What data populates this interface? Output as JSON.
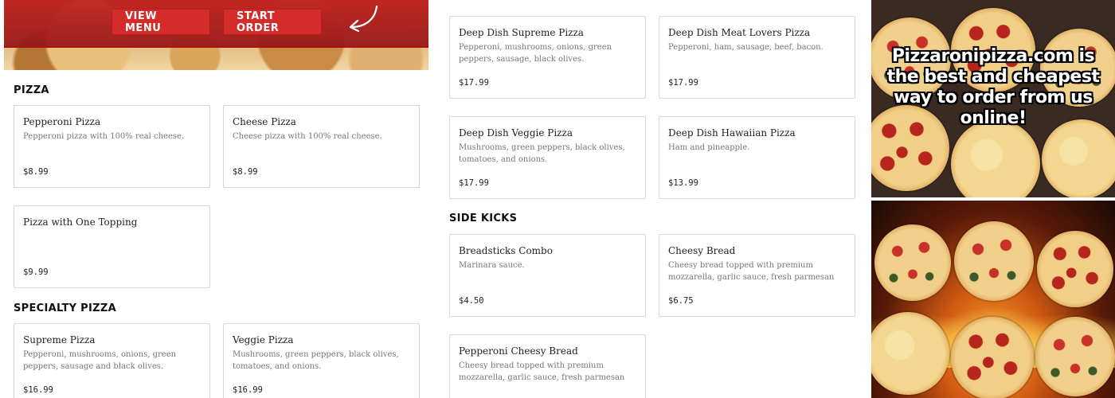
{
  "hero": {
    "view_menu_label": "VIEW MENU",
    "start_order_label": "START ORDER",
    "accent_color": "#d42b2b"
  },
  "sections": {
    "pizza": "PIZZA",
    "specialty_pizza": "SPECIALTY PIZZA",
    "side_kicks": "SIDE KICKS"
  },
  "items": {
    "pepperoni": {
      "name": "Pepperoni Pizza",
      "desc": "Pepperoni pizza with 100% real cheese.",
      "price": "$8.99"
    },
    "cheese": {
      "name": "Cheese Pizza",
      "desc": "Cheese pizza with 100% real cheese.",
      "price": "$8.99"
    },
    "one_topping": {
      "name": "Pizza with One Topping",
      "desc": "",
      "price": "$9.99"
    },
    "supreme": {
      "name": "Supreme Pizza",
      "desc": "Pepperoni, mushrooms, onions, green peppers, sausage and black olives.",
      "price": "$16.99"
    },
    "veggie": {
      "name": "Veggie Pizza",
      "desc": "Mushrooms, green peppers, black olives, tomatoes, and onions.",
      "price": "$16.99"
    },
    "dd_supreme": {
      "name": "Deep Dish Supreme Pizza",
      "desc": "Pepperoni, mushrooms, onions, green peppers, sausage, black olives.",
      "price": "$17.99"
    },
    "dd_meat": {
      "name": "Deep Dish Meat Lovers Pizza",
      "desc": "Pepperoni, ham, sausage, beef, bacon.",
      "price": "$17.99"
    },
    "dd_veggie": {
      "name": "Deep Dish Veggie Pizza",
      "desc": "Mushrooms, green peppers, black olives, tomatoes, and onions.",
      "price": "$17.99"
    },
    "dd_hawaiian": {
      "name": "Deep Dish Hawaiian Pizza",
      "desc": "Ham and pineapple.",
      "price": "$13.99"
    },
    "breadsticks": {
      "name": "Breadsticks Combo",
      "desc": "Marinara sauce.",
      "price": "$4.50"
    },
    "cheesy_bread": {
      "name": "Cheesy Bread",
      "desc": "Cheesy bread topped with premium mozzarella, garlic sauce, fresh parmesan cheese, and Italian...",
      "price": "$6.75"
    },
    "pep_cheesy_bread": {
      "name": "Pepperoni Cheesy Bread",
      "desc": "Cheesy bread topped with premium mozzarella, garlic sauce, fresh parmesan cheese, and Italian...",
      "price": ""
    }
  },
  "promo": {
    "text": "Pizzaronipizza.com is the best and cheapest way to order from us online!"
  }
}
